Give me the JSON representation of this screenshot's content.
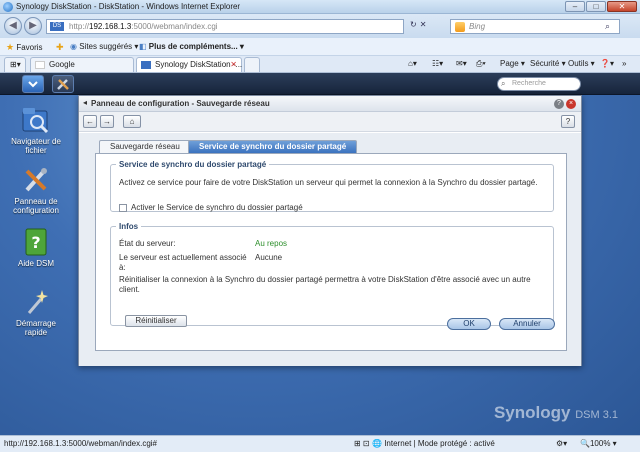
{
  "browser": {
    "title": "Synology DiskStation - DiskStation - Windows Internet Explorer",
    "url_prefix": "http://",
    "url_host": "192.168.1.3",
    "url_path": ":5000/webman/index.cgi",
    "search_placeholder": "Bing",
    "favorites": {
      "label": "Favoris",
      "suggested": "Sites suggérés ▾",
      "more": "Plus de compléments... ▾"
    },
    "tabs": [
      {
        "label": "Google"
      },
      {
        "label": "Synology DiskStation -..."
      }
    ],
    "command_bar": {
      "page": "Page ▾",
      "security": "Sécurité ▾",
      "tools": "Outils ▾"
    },
    "status": {
      "url": "http://192.168.1.3:5000/webman/index.cgi#",
      "zone": "Internet | Mode protégé : activé",
      "zoom": "100%"
    }
  },
  "dsm": {
    "search_placeholder": "Recherche",
    "desktop_icons": [
      {
        "label": "Navigateur de fichier"
      },
      {
        "label": "Panneau de configuration"
      },
      {
        "label": "Aide DSM"
      },
      {
        "label": "Démarrage rapide"
      }
    ],
    "brand": "Synology",
    "brand_tag": "DSM 3.1"
  },
  "window": {
    "title": "Panneau de configuration - Sauvegarde réseau",
    "tabs": [
      {
        "label": "Sauvegarde réseau",
        "active": false
      },
      {
        "label": "Service de synchro du dossier partagé",
        "active": true
      }
    ],
    "service": {
      "legend": "Service de synchro du dossier partagé",
      "description": "Activez ce service pour faire de votre DiskStation un serveur qui permet la connexion à la Synchro du dossier partagé.",
      "checkbox_label": "Activer le Service de synchro du dossier partagé",
      "checked": false
    },
    "infos": {
      "legend": "Infos",
      "server_state_label": "État du serveur:",
      "server_state_value": "Au repos",
      "associated_label": "Le serveur est actuellement associé à:",
      "associated_value": "Aucune",
      "reset_note": "Réinitialiser la connexion à la Synchro du dossier partagé permettra à votre DiskStation d'être associé avec un autre client.",
      "reset_button": "Réinitialiser"
    },
    "ok_button": "OK",
    "cancel_button": "Annuler"
  }
}
